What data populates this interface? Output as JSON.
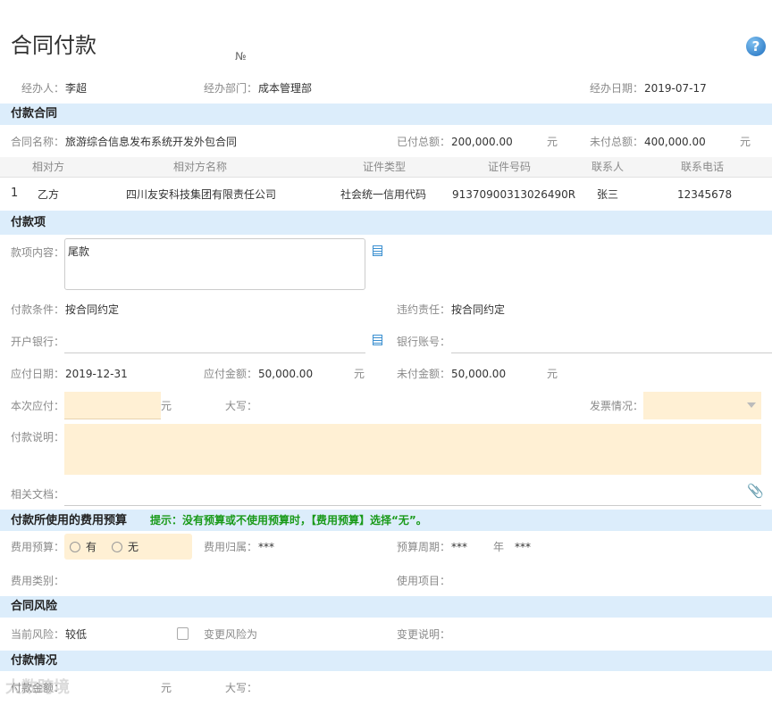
{
  "header": {
    "title": "合同付款",
    "number_label": "№",
    "help_icon": "help-circle-icon"
  },
  "meta": {
    "handler_label": "经办人：",
    "handler": "李超",
    "dept_label": "经办部门：",
    "dept": "成本管理部",
    "date_label": "经办日期：",
    "date": "2019-07-17"
  },
  "contract": {
    "section": "付款合同",
    "name_label": "合同名称：",
    "name": "旅游综合信息发布系统开发外包合同",
    "paid_label": "已付总额：",
    "paid": "200,000.00",
    "unpaid_label": "未付总额：",
    "unpaid": "400,000.00",
    "unit": "元",
    "columns": [
      "相对方",
      "相对方名称",
      "证件类型",
      "证件号码",
      "联系人",
      "联系电话"
    ],
    "rows": [
      [
        "1",
        "乙方",
        "四川友安科技集团有限责任公司",
        "社会统一信用代码",
        "91370900313026490R",
        "张三",
        "12345678"
      ]
    ]
  },
  "item": {
    "section": "付款项",
    "content_label": "款项内容：",
    "content": "尾款",
    "terms_label": "付款条件：",
    "terms": "按合同约定",
    "liability_label": "违约责任：",
    "liability": "按合同约定",
    "bank_label": "开户银行：",
    "account_label": "银行账号：",
    "due_date_label": "应付日期：",
    "due_date": "2019-12-31",
    "due_amount_label": "应付金额：",
    "due_amount": "50,000.00",
    "unpaid_label": "未付金额：",
    "unpaid": "50,000.00",
    "unit": "元",
    "this_pay_label": "本次应付：",
    "upper_label": "大写：",
    "invoice_label": "发票情况：",
    "desc_label": "付款说明：",
    "docs_label": "相关文档："
  },
  "budget": {
    "section": "付款所使用的费用预算",
    "hint": "提示：没有预算或不使用预算时，【费用预算】选择“无”。",
    "hint_color": "#1a9a1a",
    "budget_label": "费用预算：",
    "opt_yes": "有",
    "opt_no": "无",
    "owner_label": "费用归属：",
    "owner": "***",
    "period_label": "预算周期：",
    "period": "***",
    "year": "年",
    "period2": "***",
    "category_label": "费用类别：",
    "project_label": "使用项目："
  },
  "risk": {
    "section": "合同风险",
    "current_label": "当前风险：",
    "current": "较低",
    "change_label": "变更风险为",
    "change_desc_label": "变更说明："
  },
  "payment": {
    "section": "付款情况",
    "amount_label": "付款金额：",
    "unit": "元",
    "upper_label": "大写："
  },
  "watermark": "大数跨境"
}
